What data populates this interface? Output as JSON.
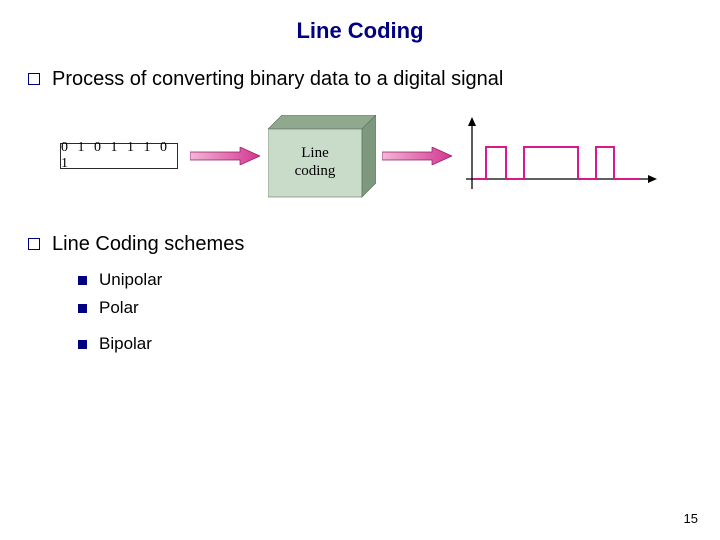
{
  "title": "Line Coding",
  "bullet1": "Process of converting binary data to a digital signal",
  "bullet2": "Line Coding schemes",
  "schemes": {
    "item1": "Unipolar",
    "item2": "Polar",
    "item3": "Bipolar"
  },
  "diagram": {
    "binary": "0 1 0 1 1 1 0 1",
    "box_line1": "Line",
    "box_line2": "coding"
  },
  "page_number": "15"
}
